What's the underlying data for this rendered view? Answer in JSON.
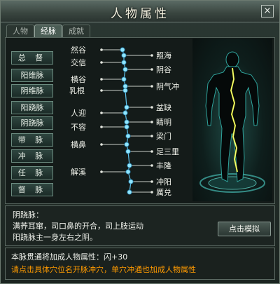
{
  "window": {
    "title": "人物属性",
    "close_label": "×"
  },
  "tabs": [
    {
      "label": "人物",
      "active": false
    },
    {
      "label": "经脉",
      "active": true
    },
    {
      "label": "成就",
      "active": false
    }
  ],
  "meridians": [
    "总 督",
    "阳维脉",
    "阴维脉",
    "阳跷脉",
    "阴跷脉",
    "带 脉",
    "冲 脉",
    "任 脉",
    "督 脉"
  ],
  "acupoints_left": [
    "然谷",
    "交信",
    "横谷",
    "乳根",
    "人迎",
    "不容",
    "横鼻",
    "解溪"
  ],
  "acupoints_right": [
    "照海",
    "阴谷",
    "阴气冲",
    "盆缺",
    "睛明",
    "梁门",
    "足三里",
    "丰隆",
    "冲阳",
    "厲兑"
  ],
  "description": {
    "name": "阴跷脉：",
    "line1": "满荞耳窜，司口鼻的开合，司上肢运动",
    "line2": "阳跷脉主一身左右之阴。"
  },
  "simulate_button": "点击模拟",
  "footer": {
    "bonus": "本脉贯通将加成人物属性：闪+30",
    "hint": "请点击具体穴位名开脉冲穴，单穴冲通也加成人物属性"
  },
  "colors": {
    "accent_text": "#ff9a00",
    "node": "#6fd8ff",
    "line": "#d8dcd6",
    "glow": "#d6e21f"
  }
}
